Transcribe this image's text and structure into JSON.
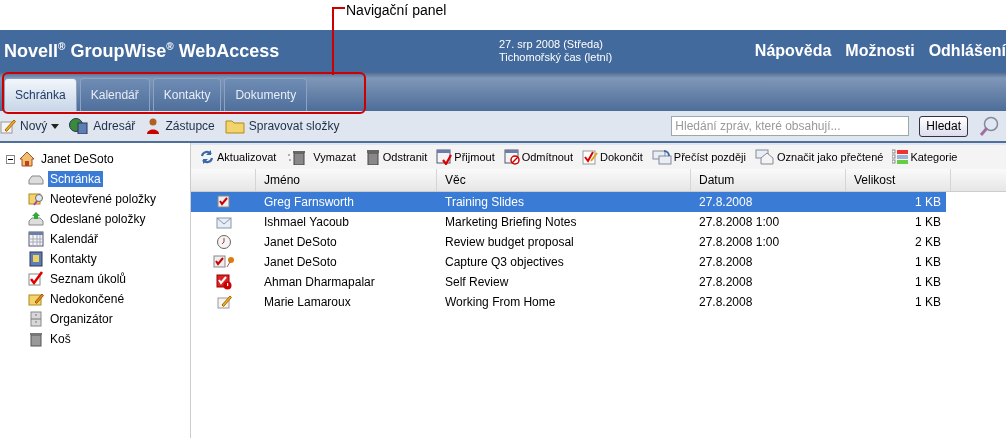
{
  "callout": {
    "label": "Navigační panel"
  },
  "header": {
    "brand": "Novell$^{®}$ GroupWise$^{®}$ WebAccess",
    "date": "27. srp 2008 (Středa)",
    "timezone": "Tichomořský čas (letní)",
    "links": [
      "Nápověda",
      "Možnosti",
      "Odhlášení"
    ]
  },
  "tabs": [
    {
      "label": "Schránka",
      "selected": true
    },
    {
      "label": "Kalendář",
      "selected": false
    },
    {
      "label": "Kontakty",
      "selected": false
    },
    {
      "label": "Dokumenty",
      "selected": false
    }
  ],
  "toolbar": {
    "items": [
      {
        "label": "Nový",
        "kind": "new"
      },
      {
        "label": "Adresář",
        "kind": "addressbook"
      },
      {
        "label": "Zástupce",
        "kind": "proxy"
      },
      {
        "label": "Spravovat složky",
        "kind": "folder"
      }
    ],
    "search": {
      "placeholder": "Hledání zpráv, které obsahují..."
    },
    "search_button": "Hledat"
  },
  "sidebar": {
    "root": {
      "label": "Janet DeSoto",
      "expanded": true,
      "children": [
        {
          "label": "Schránka",
          "kind": "mailbox",
          "selected": true
        },
        {
          "label": "Neotevřené položky",
          "kind": "unopened",
          "selected": false
        },
        {
          "label": "Odeslané položky",
          "kind": "sent",
          "selected": false
        },
        {
          "label": "Kalendář",
          "kind": "calendar",
          "selected": false
        },
        {
          "label": "Kontakty",
          "kind": "contacts",
          "selected": false
        },
        {
          "label": "Seznam úkolů",
          "kind": "tasks",
          "selected": false
        },
        {
          "label": "Nedokončené",
          "kind": "work",
          "selected": false
        },
        {
          "label": "Organizátor",
          "kind": "cabinet",
          "selected": false
        },
        {
          "label": "Koš",
          "kind": "trash",
          "selected": false
        }
      ]
    }
  },
  "actions": [
    {
      "label": "Aktualizovat",
      "kind": "refresh"
    },
    {
      "label": "Vymazat",
      "kind": "purge"
    },
    {
      "label": "Odstranit",
      "kind": "delete"
    },
    {
      "label": "Přijmout",
      "kind": "accept"
    },
    {
      "label": "Odmítnout",
      "kind": "decline"
    },
    {
      "label": "Dokončit",
      "kind": "complete"
    },
    {
      "label": "Přečíst později",
      "kind": "readlater"
    },
    {
      "label": "Označit jako přečtené",
      "kind": "markread"
    },
    {
      "label": "Kategorie",
      "kind": "categories"
    }
  ],
  "table": {
    "columns": [
      "Jméno",
      "Věc",
      "Datum",
      "Velikost"
    ],
    "rows": [
      {
        "kind": "task",
        "name": "Greg Farnsworth",
        "subject": "Training Slides",
        "date": "27.8.2008",
        "size": "1 KB",
        "selected": true
      },
      {
        "kind": "mail",
        "name": "Ishmael Yacoub",
        "subject": "Marketing Briefing Notes",
        "date": "27.8.2008 1:00",
        "size": "1 KB",
        "selected": false
      },
      {
        "kind": "appointment",
        "name": "Janet DeSoto",
        "subject": "Review budget proposal",
        "date": "27.8.2008 1:00",
        "size": "2 KB",
        "selected": false
      },
      {
        "kind": "task-pinned",
        "name": "Janet DeSoto",
        "subject": "Capture Q3 objectives",
        "date": "27.8.2008",
        "size": "1 KB",
        "selected": false
      },
      {
        "kind": "task-urgent",
        "name": "Ahman Dharmapalar",
        "subject": "Self Review",
        "date": "27.8.2008",
        "size": "1 KB",
        "selected": false
      },
      {
        "kind": "note",
        "name": "Marie Lamaroux",
        "subject": "Working From Home",
        "date": "27.8.2008",
        "size": "1 KB",
        "selected": false
      }
    ]
  }
}
